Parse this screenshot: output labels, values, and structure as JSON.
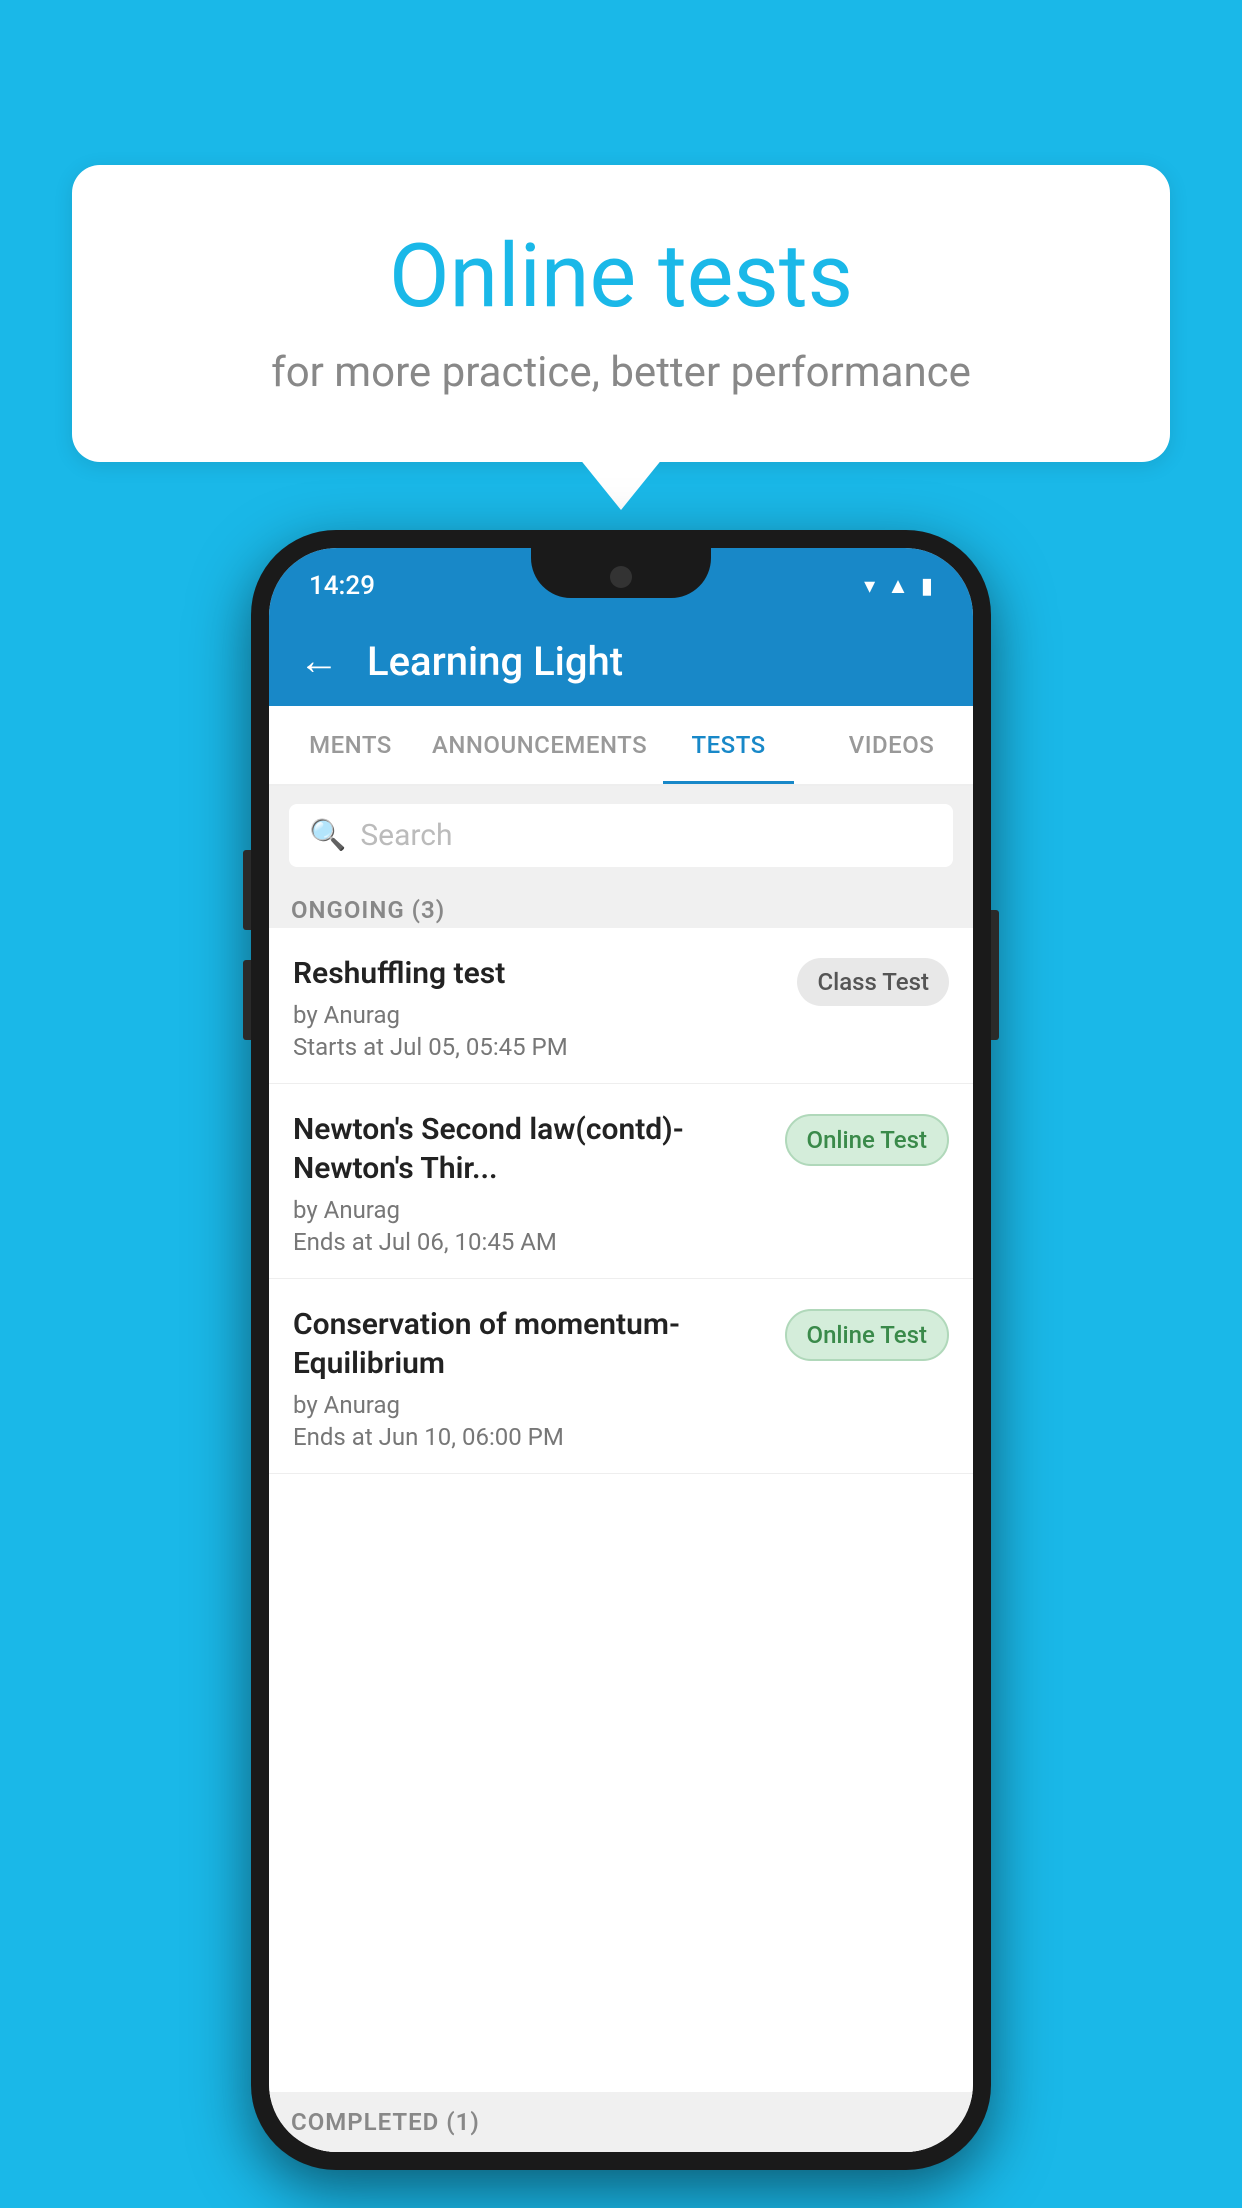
{
  "background_color": "#1ab8e8",
  "bubble": {
    "title": "Online tests",
    "subtitle": "for more practice, better performance"
  },
  "phone": {
    "status_bar": {
      "time": "14:29",
      "icons": [
        "wifi",
        "signal",
        "battery"
      ]
    },
    "header": {
      "back_label": "←",
      "title": "Learning Light"
    },
    "tabs": [
      {
        "label": "MENTS",
        "active": false
      },
      {
        "label": "ANNOUNCEMENTS",
        "active": false
      },
      {
        "label": "TESTS",
        "active": true
      },
      {
        "label": "VIDEOS",
        "active": false
      }
    ],
    "search": {
      "placeholder": "Search"
    },
    "ongoing_label": "ONGOING (3)",
    "tests": [
      {
        "name": "Reshuffling test",
        "by": "by Anurag",
        "date": "Starts at  Jul 05, 05:45 PM",
        "badge": "Class Test",
        "badge_type": "class"
      },
      {
        "name": "Newton's Second law(contd)-Newton's Thir...",
        "by": "by Anurag",
        "date": "Ends at  Jul 06, 10:45 AM",
        "badge": "Online Test",
        "badge_type": "online"
      },
      {
        "name": "Conservation of momentum-Equilibrium",
        "by": "by Anurag",
        "date": "Ends at  Jun 10, 06:00 PM",
        "badge": "Online Test",
        "badge_type": "online"
      }
    ],
    "completed_label": "COMPLETED (1)"
  }
}
